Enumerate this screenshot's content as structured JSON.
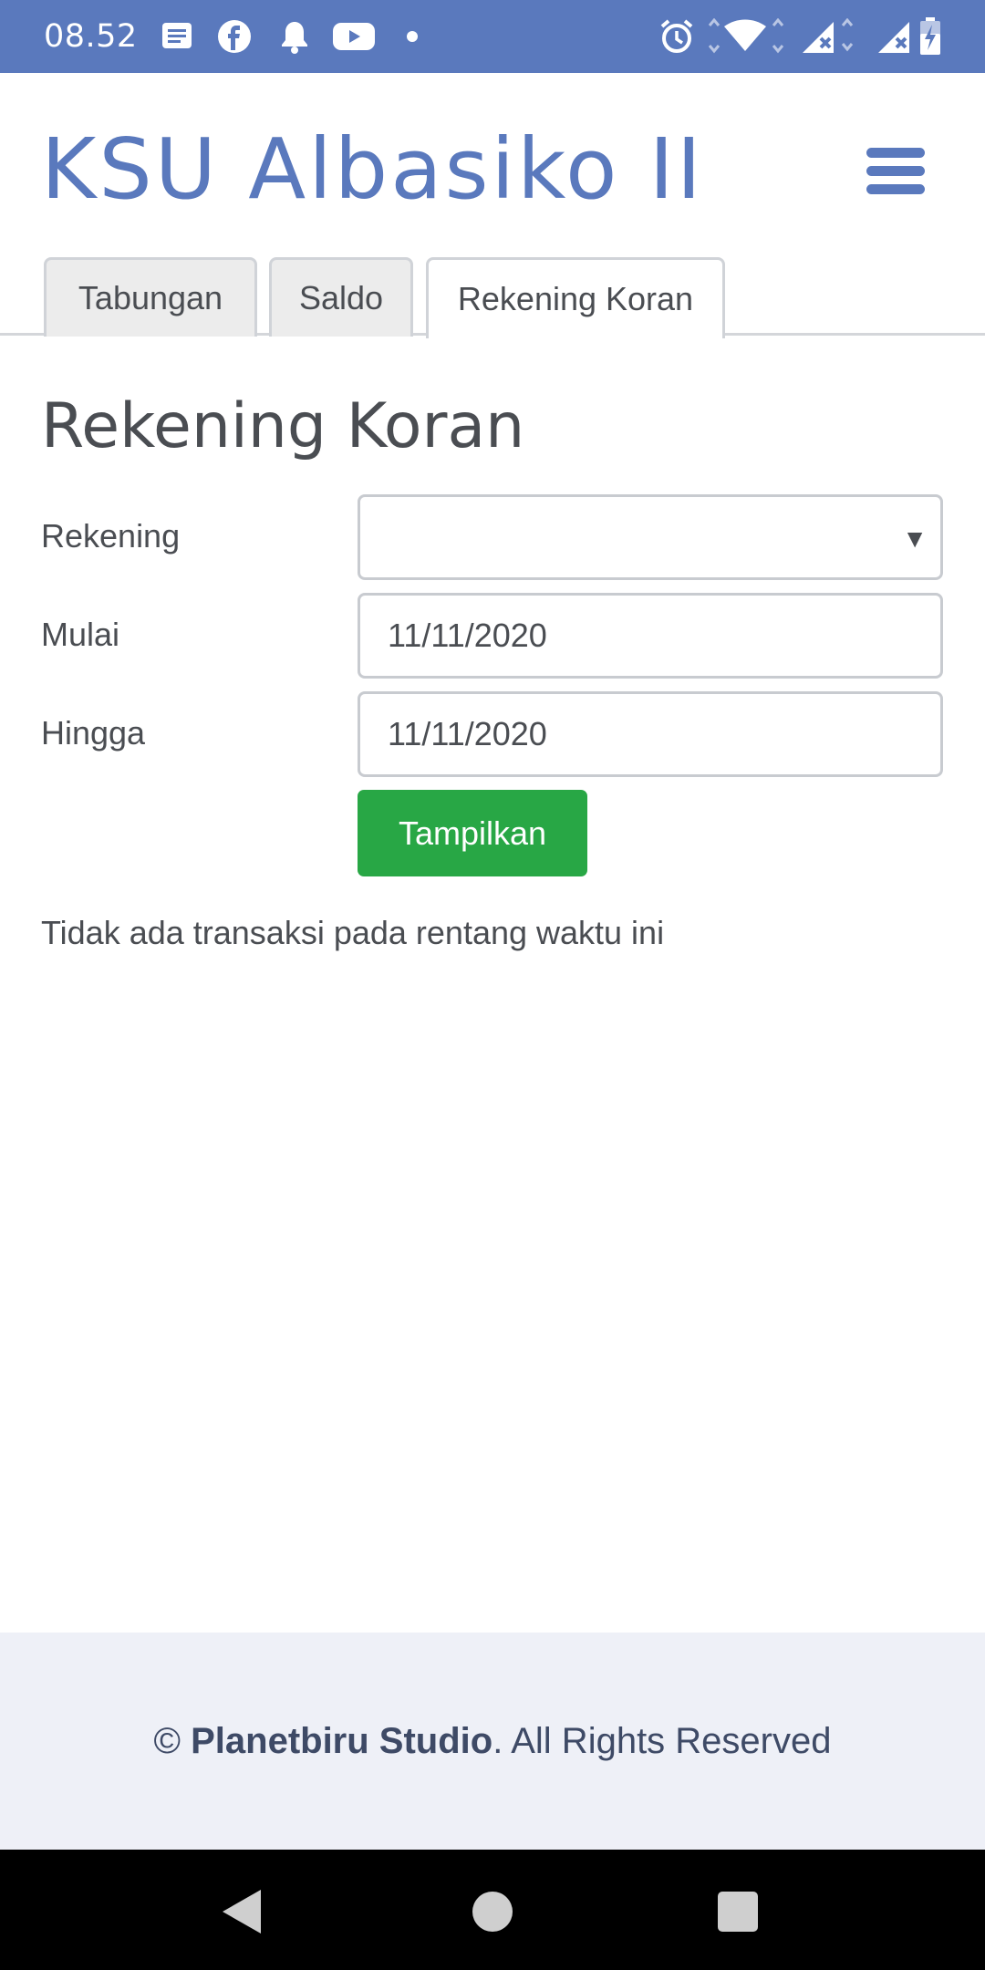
{
  "status_bar": {
    "time": "08.52",
    "left_icons": [
      "message-icon",
      "facebook-icon",
      "bell-icon",
      "youtube-icon",
      "dot-icon"
    ],
    "right_icons": [
      "alarm-icon",
      "wifi-icon",
      "signal-icon",
      "signal-icon",
      "battery-charging-icon"
    ]
  },
  "header": {
    "title": "KSU Albasiko II",
    "menu_icon": "hamburger-menu-icon"
  },
  "tabs": [
    {
      "label": "Tabungan",
      "active": false
    },
    {
      "label": "Saldo",
      "active": false
    },
    {
      "label": "Rekening Koran",
      "active": true
    }
  ],
  "page": {
    "title": "Rekening Koran"
  },
  "form": {
    "rekening_label": "Rekening",
    "rekening_value": "",
    "mulai_label": "Mulai",
    "mulai_value": "11/11/2020",
    "hingga_label": "Hingga",
    "hingga_value": "11/11/2020",
    "submit_label": "Tampilkan"
  },
  "message": "Tidak ada transaksi pada rentang waktu ini",
  "footer": {
    "copyright_symbol": "©",
    "brand": "Planetbiru Studio",
    "suffix": ". All Rights Reserved"
  },
  "colors": {
    "brand_blue": "#5a79bd",
    "button_green": "#28a745",
    "footer_bg": "#eef0f7"
  }
}
